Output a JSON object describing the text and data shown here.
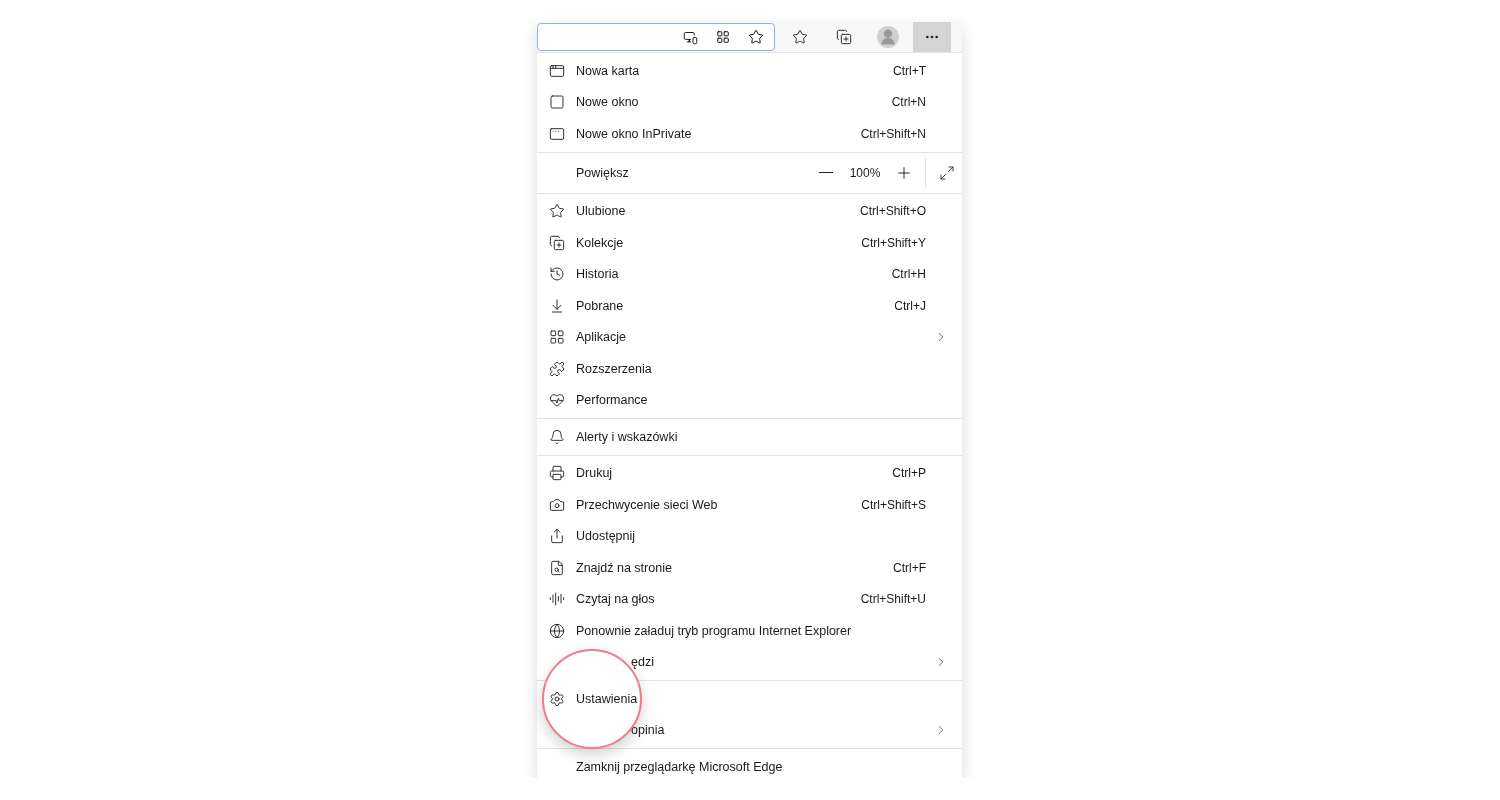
{
  "toolbar": {
    "buttons": [
      {
        "selected": false
      },
      {
        "selected": false
      },
      {
        "selected": false
      },
      {
        "selected": true
      }
    ]
  },
  "menu": {
    "sections": [
      [
        {
          "kind": "item",
          "label": "Nowa karta",
          "shortcut": "Ctrl+T"
        },
        {
          "kind": "item",
          "label": "Nowe okno",
          "shortcut": "Ctrl+N"
        },
        {
          "kind": "item",
          "label": "Nowe okno InPrivate",
          "shortcut": "Ctrl+Shift+N"
        }
      ],
      [
        {
          "kind": "zoom",
          "label": "Powiększ",
          "value": "100%"
        }
      ],
      [
        {
          "kind": "item",
          "label": "Ulubione",
          "shortcut": "Ctrl+Shift+O"
        },
        {
          "kind": "item",
          "label": "Kolekcje",
          "shortcut": "Ctrl+Shift+Y"
        },
        {
          "kind": "item",
          "label": "Historia",
          "shortcut": "Ctrl+H"
        },
        {
          "kind": "item",
          "label": "Pobrane",
          "shortcut": "Ctrl+J"
        },
        {
          "kind": "item",
          "label": "Aplikacje",
          "submenu": true
        },
        {
          "kind": "item",
          "label": "Rozszerzenia"
        },
        {
          "kind": "item",
          "label": "Performance"
        }
      ],
      [
        {
          "kind": "item",
          "label": "Alerty i wskazówki"
        }
      ],
      [
        {
          "kind": "item",
          "label": "Drukuj",
          "shortcut": "Ctrl+P"
        },
        {
          "kind": "item",
          "label": "Przechwycenie sieci Web",
          "shortcut": "Ctrl+Shift+S"
        },
        {
          "kind": "item",
          "label": "Udostępnij"
        },
        {
          "kind": "item",
          "label": "Znajdź na stronie",
          "shortcut": "Ctrl+F"
        },
        {
          "kind": "item",
          "label": "Czytaj na głos",
          "shortcut": "Ctrl+Shift+U"
        },
        {
          "kind": "item",
          "label": "Ponownie załaduj tryb programu Internet Explorer"
        },
        {
          "kind": "item",
          "label": "ędzi",
          "submenu": true,
          "covered": true
        }
      ],
      [
        {
          "kind": "item",
          "label": "Ustawienia",
          "highlighted": true
        },
        {
          "kind": "item",
          "label": "opinia",
          "submenu": true,
          "covered": true
        }
      ],
      [
        {
          "kind": "item",
          "label": "Zamknij przeglądarkę Microsoft Edge"
        }
      ]
    ]
  }
}
